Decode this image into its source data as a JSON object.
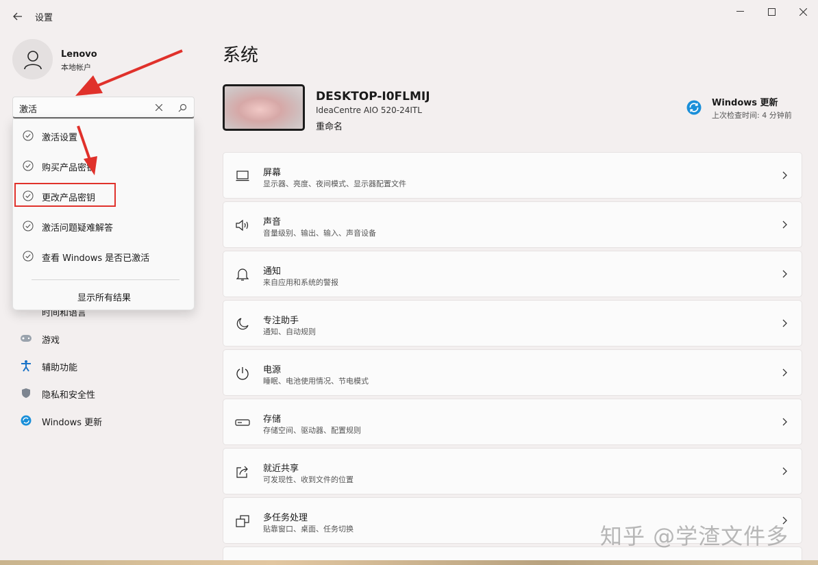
{
  "window": {
    "title": "设置",
    "minimize_icon": "minimize-icon",
    "maximize_icon": "maximize-icon",
    "close_icon": "close-icon"
  },
  "profile": {
    "name": "Lenovo",
    "account_type": "本地帐户"
  },
  "search": {
    "value": "激活",
    "suggestions": [
      {
        "label": "激活设置"
      },
      {
        "label": "购买产品密钥"
      },
      {
        "label": "更改产品密钥"
      },
      {
        "label": "激活问题疑难解答"
      },
      {
        "label": "查看 Windows 是否已激活"
      }
    ],
    "show_all": "显示所有结果"
  },
  "sidebar": {
    "partial_item": "时间和语言",
    "items": [
      {
        "label": "游戏",
        "icon": "gamepad-icon"
      },
      {
        "label": "辅助功能",
        "icon": "accessibility-icon"
      },
      {
        "label": "隐私和安全性",
        "icon": "shield-icon"
      },
      {
        "label": "Windows 更新",
        "icon": "windows-update-icon"
      }
    ]
  },
  "main": {
    "title": "系统",
    "device": {
      "name": "DESKTOP-I0FLMIJ",
      "model": "IdeaCentre AIO 520-24ITL",
      "rename": "重命名"
    },
    "windows_update": {
      "title": "Windows 更新",
      "subtitle": "上次检查时间: 4 分钟前"
    },
    "cards": [
      {
        "title": "屏幕",
        "subtitle": "显示器、亮度、夜间模式、显示器配置文件",
        "icon": "monitor-icon"
      },
      {
        "title": "声音",
        "subtitle": "音量级别、输出、输入、声音设备",
        "icon": "speaker-icon"
      },
      {
        "title": "通知",
        "subtitle": "来自应用和系统的警报",
        "icon": "bell-icon"
      },
      {
        "title": "专注助手",
        "subtitle": "通知、自动规则",
        "icon": "moon-icon"
      },
      {
        "title": "电源",
        "subtitle": "睡眠、电池使用情况、节电模式",
        "icon": "power-icon"
      },
      {
        "title": "存储",
        "subtitle": "存储空间、驱动器、配置规则",
        "icon": "storage-icon"
      },
      {
        "title": "就近共享",
        "subtitle": "可发现性、收到文件的位置",
        "icon": "share-icon"
      },
      {
        "title": "多任务处理",
        "subtitle": "贴靠窗口、桌面、任务切换",
        "icon": "multitask-icon"
      }
    ]
  },
  "watermark": "知乎 @学渣文件多",
  "colors": {
    "highlight": "#e0312b",
    "arrow": "#e0312b",
    "accent": "#0a7bd1"
  }
}
